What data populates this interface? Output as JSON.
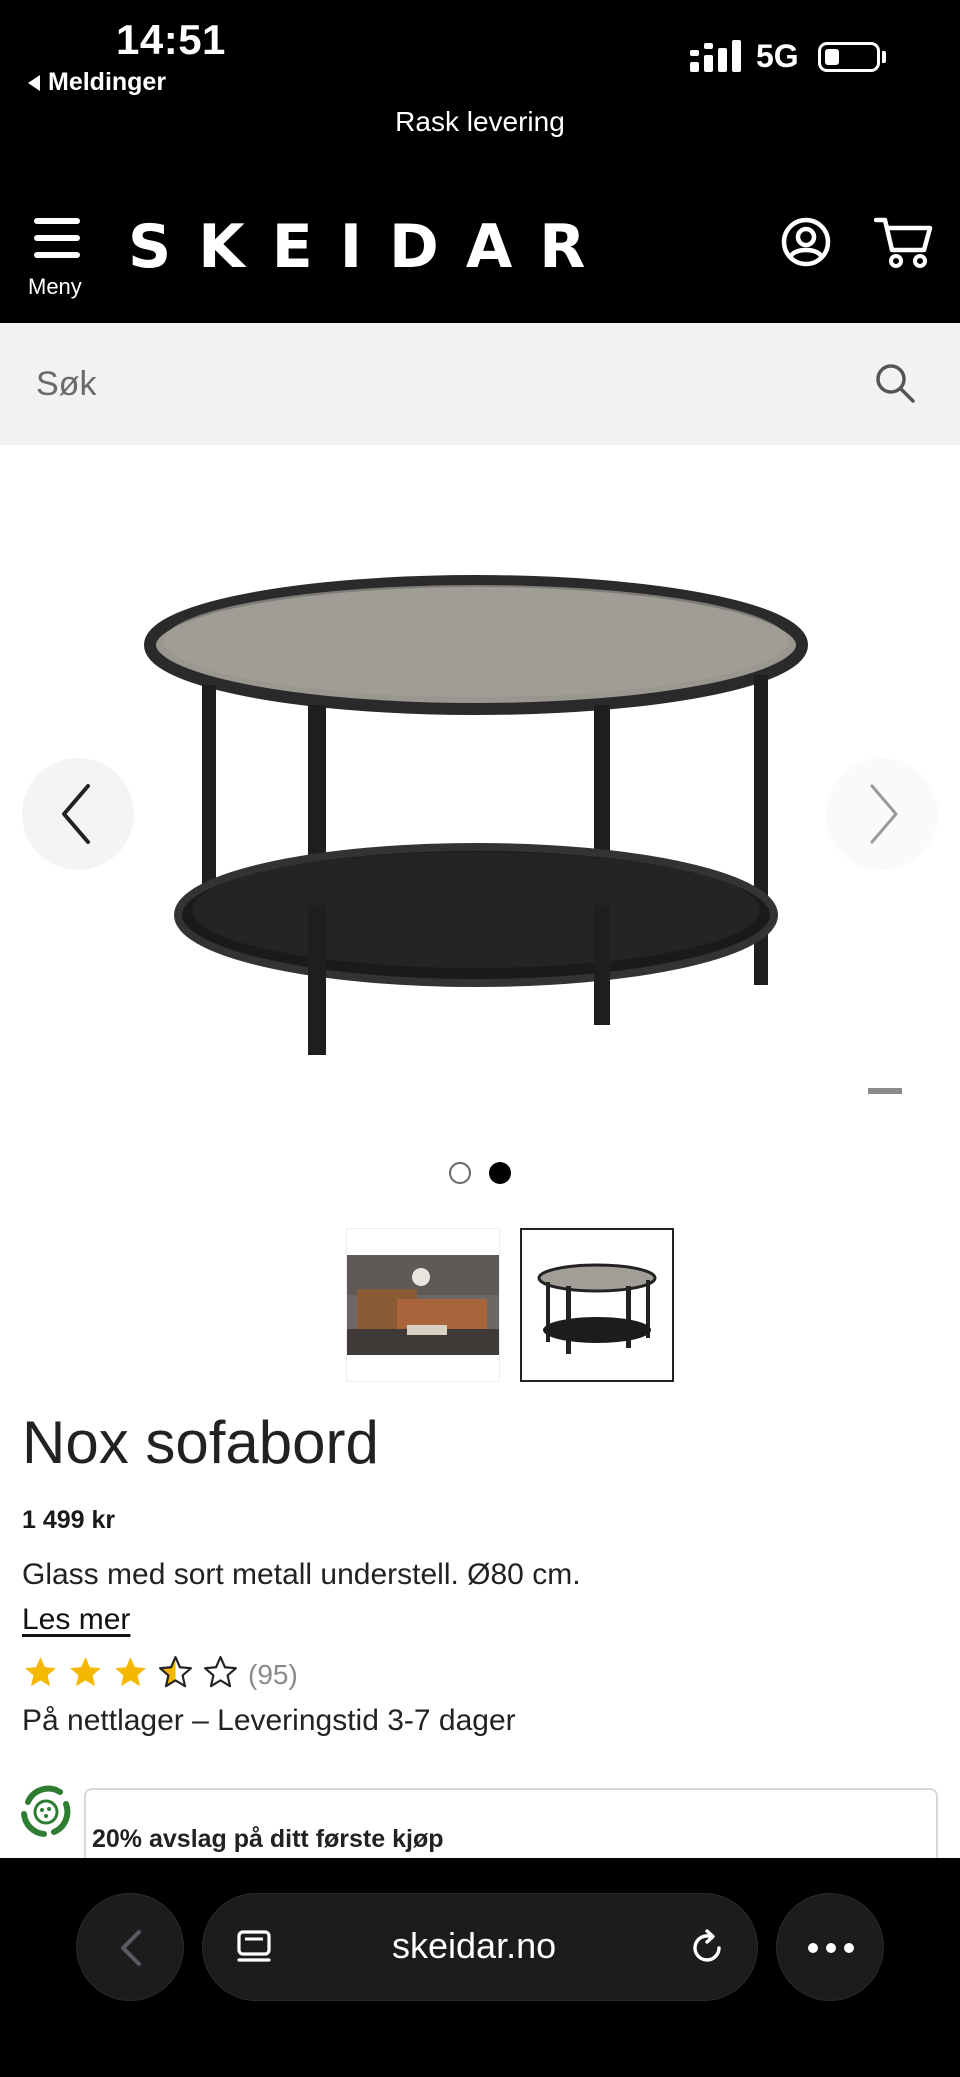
{
  "status_bar": {
    "time": "14:51",
    "back_app": "Meldinger",
    "network": "5G"
  },
  "header": {
    "promo": "Rask levering",
    "menu_label": "Meny",
    "logo": "SKEIDAR",
    "icons": [
      "menu-icon",
      "account-icon",
      "cart-icon"
    ]
  },
  "search": {
    "placeholder": "Søk",
    "icon": "search-icon"
  },
  "gallery": {
    "active_slide": 2,
    "slide_count": 2,
    "thumbnails": [
      "living-room-thumbnail",
      "table-thumbnail"
    ]
  },
  "product": {
    "title": "Nox sofabord",
    "price": "1 499 kr",
    "description": "Glass med sort metall understell. Ø80 cm.",
    "read_more": "Les mer",
    "rating": 3.5,
    "rating_max": 5,
    "reviews": "(95)",
    "stock": "På nettlager – Leveringstid 3-7 dager"
  },
  "offer": {
    "text": "20% avslag på ditt første kjøp"
  },
  "browser": {
    "url": "skeidar.no"
  },
  "colors": {
    "header_bg": "#000000",
    "star": "#F5B800",
    "search_bg": "#F2F2F2"
  }
}
